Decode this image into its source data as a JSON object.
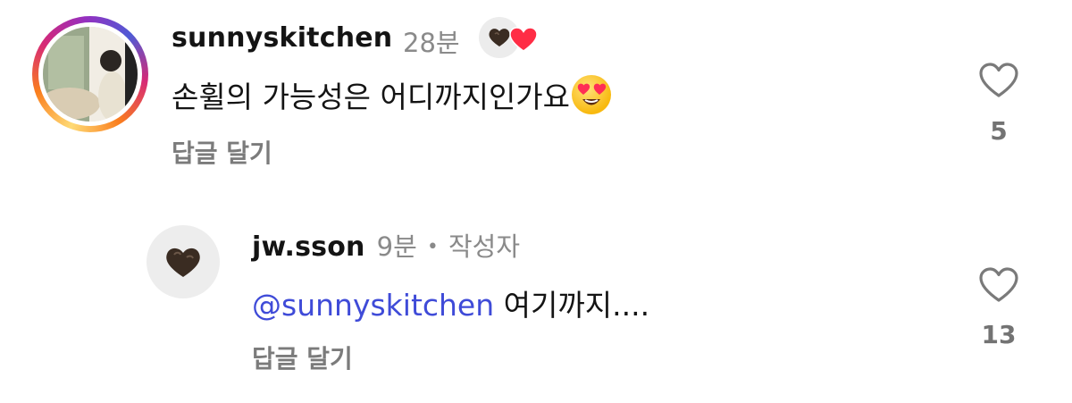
{
  "comments": [
    {
      "username": "sunnyskitchen",
      "time": "28분",
      "text": "손휠의 가능성은 어디까지인가요",
      "emoji": "heart-eyes-emoji",
      "reply_label": "답글 달기",
      "likes": "5",
      "liked_by_creator": true
    },
    {
      "username": "jw.sson",
      "time": "9분",
      "separator": "•",
      "author_tag": "작성자",
      "mention": "@sunnyskitchen",
      "text": "여기까지....",
      "reply_label": "답글 달기",
      "likes": "13"
    }
  ],
  "colors": {
    "mention": "#3f4bd8",
    "heart_red": "#ff2d45",
    "secondary_text": "#8a8a8a"
  }
}
